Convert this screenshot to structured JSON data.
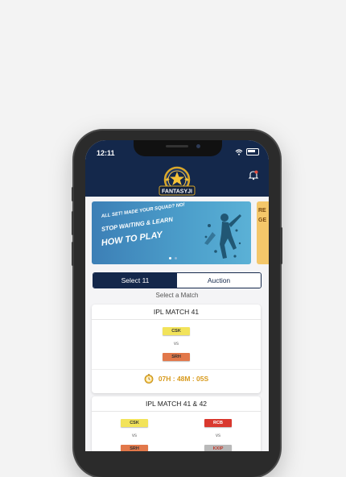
{
  "status_bar": {
    "time": "12:11"
  },
  "header": {
    "logo_text": "FANTASYJI",
    "bell_icon": "bell-icon"
  },
  "banner": {
    "line1": "ALL SET! MADE YOUR SQUAD? NO!",
    "line2": "STOP WAITING & LEARN",
    "line3": "HOW TO PLAY",
    "peek_lines": [
      "RE",
      "GE"
    ]
  },
  "tabs": {
    "select11": "Select 11",
    "auction": "Auction"
  },
  "select_match_label": "Select a Match",
  "matches": [
    {
      "title": "IPL MATCH 41",
      "team1": "CSK",
      "vs": "vs",
      "team2": "SRH",
      "countdown": "07H : 48M : 05S"
    },
    {
      "title": "IPL MATCH 41 & 42",
      "pairs": [
        {
          "team1": "CSK",
          "vs": "vs",
          "team2": "SRH"
        },
        {
          "team1": "RCB",
          "vs": "vs",
          "team2": "KXIP"
        }
      ]
    }
  ],
  "colors": {
    "navy": "#14284b",
    "csk": "#f2e35a",
    "srh": "#e2784a",
    "rcb": "#d9382e",
    "kxip": "#b9b9b9",
    "countdown": "#d89a1c"
  }
}
